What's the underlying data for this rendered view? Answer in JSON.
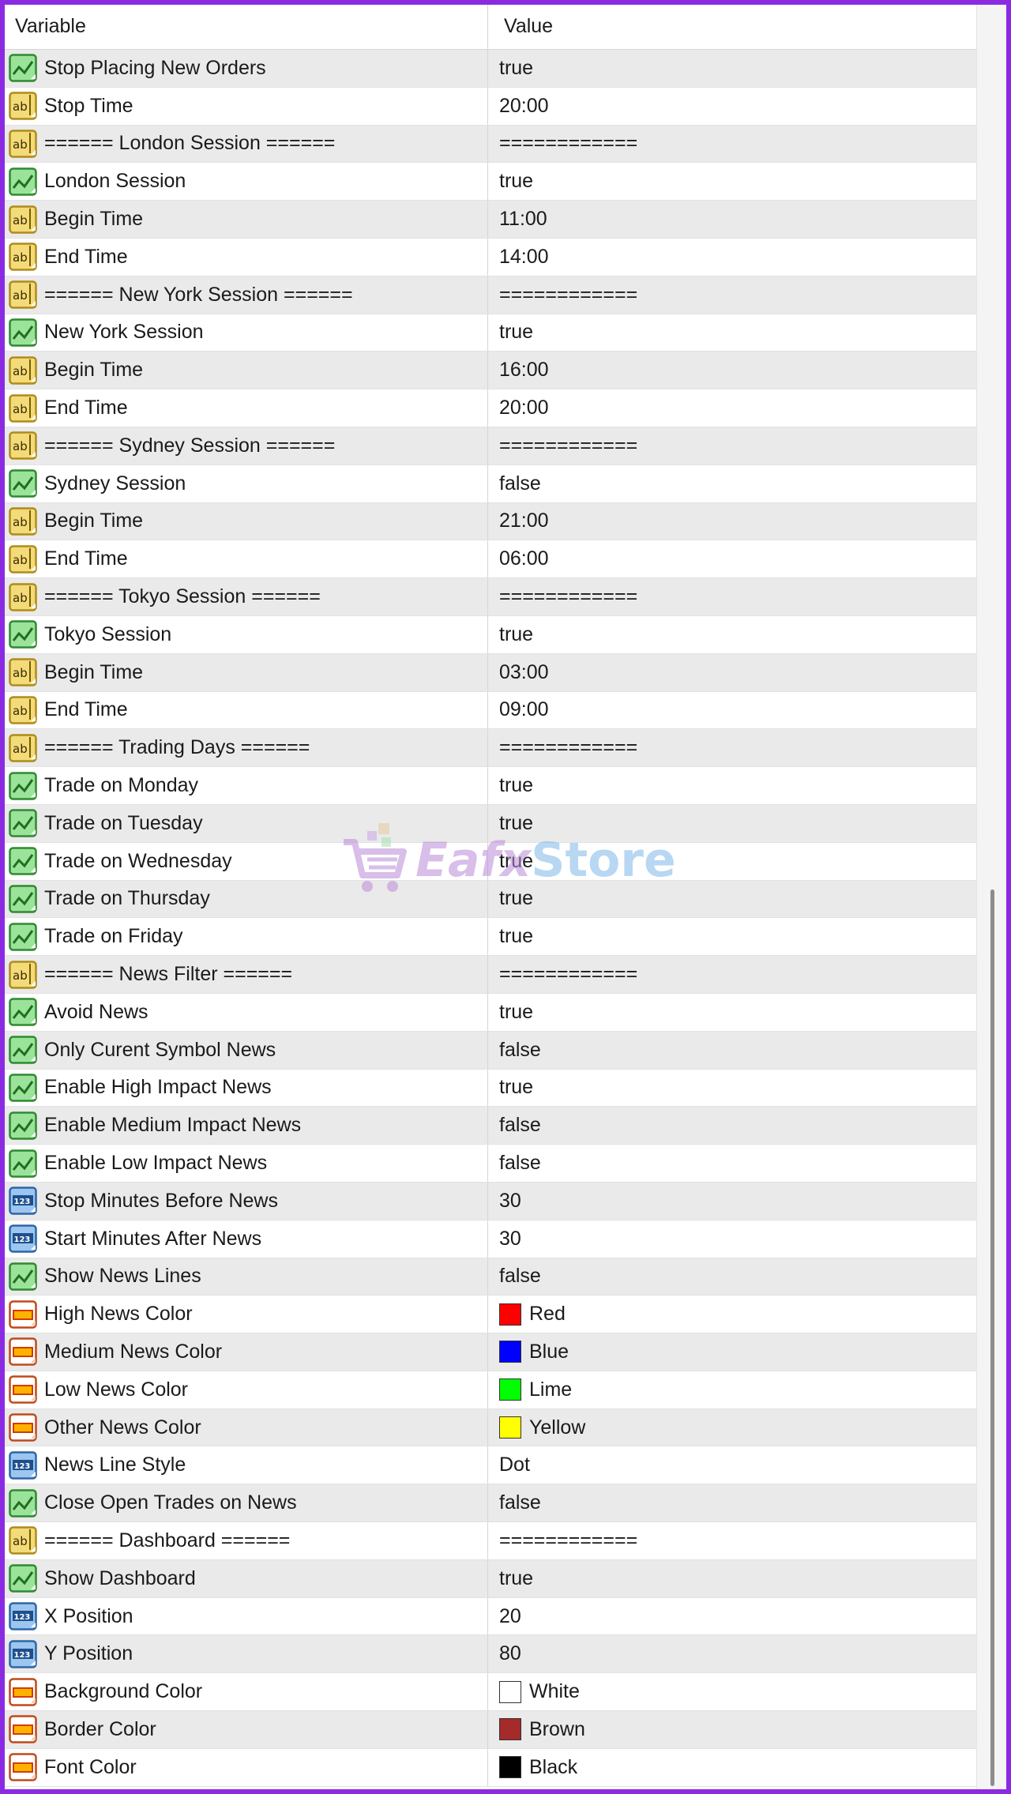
{
  "header": {
    "variable": "Variable",
    "value": "Value"
  },
  "icons": {
    "bool": "boolean-icon",
    "text": "text-ab-icon",
    "int": "number-123-icon",
    "color": "color-icon"
  },
  "rows": [
    {
      "type": "bool",
      "name": "Stop Placing New Orders",
      "value": "true"
    },
    {
      "type": "text",
      "name": "Stop Time",
      "value": "20:00"
    },
    {
      "type": "text",
      "name": "====== London Session ======",
      "value": "============"
    },
    {
      "type": "bool",
      "name": "London Session",
      "value": "true"
    },
    {
      "type": "text",
      "name": "Begin Time",
      "value": "11:00"
    },
    {
      "type": "text",
      "name": "End Time",
      "value": "14:00"
    },
    {
      "type": "text",
      "name": "====== New York Session ======",
      "value": "============"
    },
    {
      "type": "bool",
      "name": "New York Session",
      "value": "true"
    },
    {
      "type": "text",
      "name": "Begin Time",
      "value": "16:00"
    },
    {
      "type": "text",
      "name": "End Time",
      "value": "20:00"
    },
    {
      "type": "text",
      "name": "====== Sydney Session ======",
      "value": "============"
    },
    {
      "type": "bool",
      "name": "Sydney Session",
      "value": "false"
    },
    {
      "type": "text",
      "name": "Begin Time",
      "value": "21:00"
    },
    {
      "type": "text",
      "name": "End Time",
      "value": "06:00"
    },
    {
      "type": "text",
      "name": "====== Tokyo Session ======",
      "value": "============"
    },
    {
      "type": "bool",
      "name": "Tokyo Session",
      "value": "true"
    },
    {
      "type": "text",
      "name": "Begin Time",
      "value": "03:00"
    },
    {
      "type": "text",
      "name": "End Time",
      "value": "09:00"
    },
    {
      "type": "text",
      "name": "====== Trading Days ======",
      "value": "============"
    },
    {
      "type": "bool",
      "name": "Trade on Monday",
      "value": "true"
    },
    {
      "type": "bool",
      "name": "Trade on Tuesday",
      "value": "true"
    },
    {
      "type": "bool",
      "name": "Trade on Wednesday",
      "value": "true"
    },
    {
      "type": "bool",
      "name": "Trade on Thursday",
      "value": "true"
    },
    {
      "type": "bool",
      "name": "Trade on Friday",
      "value": "true"
    },
    {
      "type": "text",
      "name": "====== News Filter ======",
      "value": "============"
    },
    {
      "type": "bool",
      "name": "Avoid News",
      "value": "true"
    },
    {
      "type": "bool",
      "name": "Only Curent Symbol News",
      "value": "false"
    },
    {
      "type": "bool",
      "name": "Enable High Impact News",
      "value": "true"
    },
    {
      "type": "bool",
      "name": "Enable Medium Impact News",
      "value": "false"
    },
    {
      "type": "bool",
      "name": "Enable Low Impact News",
      "value": "false"
    },
    {
      "type": "int",
      "name": "Stop Minutes Before News",
      "value": "30"
    },
    {
      "type": "int",
      "name": "Start Minutes After News",
      "value": "30"
    },
    {
      "type": "bool",
      "name": "Show News Lines",
      "value": "false"
    },
    {
      "type": "color",
      "name": "High News Color",
      "value": "Red",
      "swatch": "#ff0000"
    },
    {
      "type": "color",
      "name": "Medium News Color",
      "value": "Blue",
      "swatch": "#0000ff"
    },
    {
      "type": "color",
      "name": "Low News Color",
      "value": "Lime",
      "swatch": "#00ff00"
    },
    {
      "type": "color",
      "name": "Other News Color",
      "value": "Yellow",
      "swatch": "#ffff00"
    },
    {
      "type": "int",
      "name": "News Line Style",
      "value": "Dot"
    },
    {
      "type": "bool",
      "name": "Close Open Trades on News",
      "value": "false"
    },
    {
      "type": "text",
      "name": "====== Dashboard ======",
      "value": "============"
    },
    {
      "type": "bool",
      "name": "Show Dashboard",
      "value": "true"
    },
    {
      "type": "int",
      "name": "X Position",
      "value": "20"
    },
    {
      "type": "int",
      "name": "Y Position",
      "value": "80"
    },
    {
      "type": "color",
      "name": "Background Color",
      "value": "White",
      "swatch": "#ffffff"
    },
    {
      "type": "color",
      "name": "Border Color",
      "value": "Brown",
      "swatch": "#a52a2a"
    },
    {
      "type": "color",
      "name": "Font Color",
      "value": "Black",
      "swatch": "#000000"
    }
  ],
  "watermark": {
    "part1": "Eafx",
    "part2": "Store"
  },
  "colors": {
    "frame": "#8a2be2",
    "row_alt": "#eaeaea"
  }
}
